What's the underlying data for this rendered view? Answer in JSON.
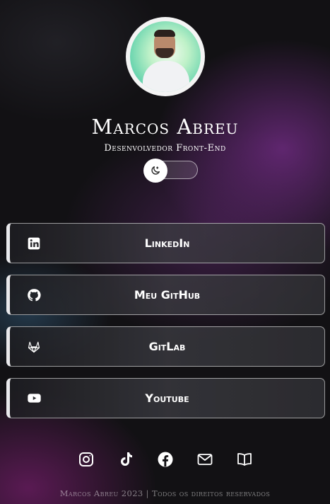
{
  "profile": {
    "name": "Marcos Abreu",
    "role": "Desenvolvedor Front-End"
  },
  "theme_toggle": {
    "icon": "moon-icon",
    "state": "dark"
  },
  "links": [
    {
      "label": "LinkedIn",
      "icon": "linkedin-icon"
    },
    {
      "label": "Meu GitHub",
      "icon": "github-icon"
    },
    {
      "label": "GitLab",
      "icon": "gitlab-icon"
    },
    {
      "label": "Youtube",
      "icon": "youtube-icon"
    }
  ],
  "socials": [
    "instagram-icon",
    "tiktok-icon",
    "facebook-icon",
    "mail-icon",
    "book-icon"
  ],
  "footer": {
    "text": "Marcos Abreu 2023 | Todos os direitos reservados"
  },
  "colors": {
    "background": "#121114",
    "accent": "#7a2d8c",
    "text": "#ffffff"
  }
}
